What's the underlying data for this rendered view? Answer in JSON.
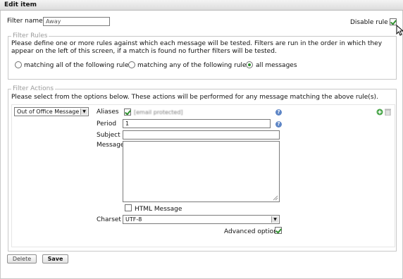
{
  "window": {
    "title": "Edit item"
  },
  "filter": {
    "name_label": "Filter name",
    "name_value": "Away",
    "disable_rule_label": "Disable rule",
    "disable_rule_checked": true
  },
  "filter_rules": {
    "legend": "Filter Rules",
    "description": "Please define one or more rules against which each message will be tested. Filters are run in the order in which they appear on the left of this screen, if a match is found no further filters will be tested.",
    "options": [
      {
        "label": "matching all of the following rules",
        "selected": false
      },
      {
        "label": "matching any of the following rules",
        "selected": false
      },
      {
        "label": "all messages",
        "selected": true
      }
    ]
  },
  "filter_actions": {
    "legend": "Filter Actions",
    "description": "Please select from the options below. These actions will be performed for any message matching the above rule(s).",
    "action_select": "Out of Office Message",
    "aliases_label": "Aliases",
    "aliases_value": "[email protected]",
    "aliases_checked": true,
    "period_label": "Period",
    "period_value": "1",
    "subject_label": "Subject",
    "subject_value": "",
    "message_label": "Message",
    "message_value": "",
    "html_message_label": "HTML Message",
    "html_message_checked": false,
    "charset_label": "Charset",
    "charset_value": "UTF-8",
    "advanced_options_label": "Advanced options",
    "advanced_options_checked": true,
    "help_glyph": "?"
  },
  "buttons": {
    "delete": "Delete",
    "save": "Save"
  },
  "icons": {
    "add": "add-icon",
    "delete": "trash-icon",
    "help": "help-icon",
    "cursor": "mouse-cursor-icon"
  },
  "colors": {
    "accent_green": "#2f8f2f",
    "help_blue": "#5e86c6",
    "legend_gray": "#9a9a9a"
  }
}
